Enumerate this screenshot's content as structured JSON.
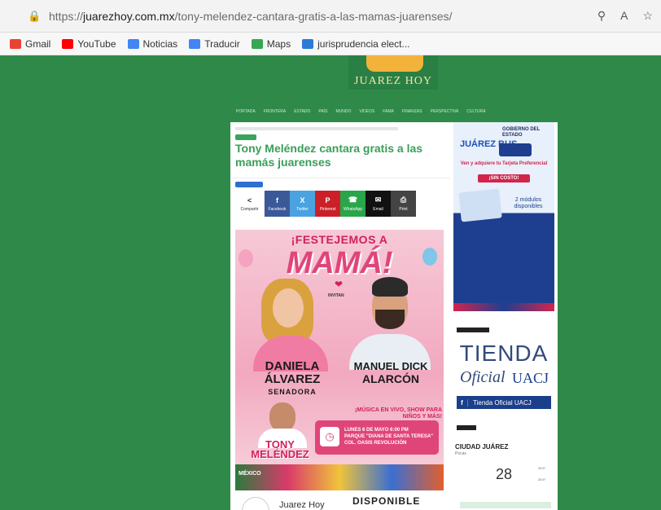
{
  "browser": {
    "url_prefix": "https://",
    "url_domain": "juarezhoy.com.mx",
    "url_path": "/tony-melendez-cantara-gratis-a-las-mamas-juarenses/"
  },
  "bookmarks": [
    {
      "label": "Gmail",
      "color": "#ea4335"
    },
    {
      "label": "YouTube",
      "color": "#ff0000"
    },
    {
      "label": "Noticias",
      "color": "#4285f4"
    },
    {
      "label": "Traducir",
      "color": "#4285f4"
    },
    {
      "label": "Maps",
      "color": "#34a853"
    },
    {
      "label": "jurisprudencia elect...",
      "color": "#2b7bd8"
    }
  ],
  "site": {
    "logo_text": "JUAREZ HOY",
    "nav": [
      "PORTADA",
      "FRONTERA",
      "ESTADO",
      "PAÍS",
      "MUNDO",
      "VIDEOS",
      "FAMA",
      "FINANZAS",
      "PERSPECTIVA",
      "CULTURA"
    ]
  },
  "article": {
    "title": "Tony Meléndez cantara gratis a las mamás juarenses",
    "share_label": "Compartir",
    "share_buttons": [
      "Facebook",
      "Twitter",
      "Pinterest",
      "WhatsApp",
      "Email",
      "Print"
    ]
  },
  "poster": {
    "headline": "¡FESTEJEMOS A",
    "mama": "MAMÁ!",
    "invitan": "INVITAN",
    "name1_line1": "DANIELA",
    "name1_line2": "ÁLVAREZ",
    "role1": "SENADORA",
    "name2_line1": "MANUEL DICK",
    "name2_line2": "ALARCÓN",
    "musica": "¡MÚSICA EN VIVO, SHOW PARA NIÑOS Y MÁS!",
    "guest_name": "TONY MELÉNDEZ",
    "event_date": "LUNES 6 DE MAYO 6:00 PM",
    "event_place": "PARQUE \"DIANA DE SANTA TERESA\"",
    "event_street": "COL. OASIS REVOLUCIÓN",
    "mexico": "MÉXICO"
  },
  "below": {
    "brand": "Juarez Hoy",
    "disponible": "DISPONIBLE"
  },
  "sidebar": {
    "ad1_gob": "GOBIERNO DEL ESTADO",
    "ad1_brand": "JUÁREZ BUS",
    "ad1_ven": "Ven y adquiere tu Tarjeta Preferencial",
    "ad1_sincosto": "¡SIN COSTO!",
    "ad1_modulos": "2 módulos disponibles",
    "tienda": "TIENDA",
    "oficial": "Oficial",
    "uacj": "UACJ",
    "fb_label": "Tienda Oficial UACJ",
    "weather_city": "CIUDAD JUÁREZ",
    "weather_desc": "Pocas",
    "weather_temp": "28",
    "weather_hi": "28.5°",
    "weather_lo": "28.5°"
  }
}
